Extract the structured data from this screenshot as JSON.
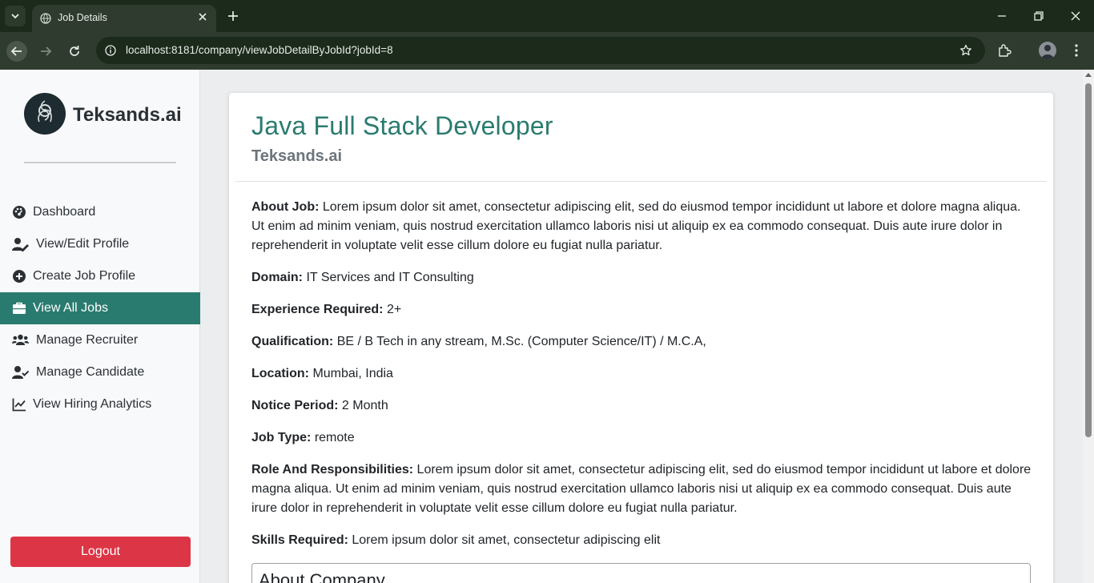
{
  "browser": {
    "tab_title": "Job Details",
    "url": "localhost:8181/company/viewJobDetailByJobId?jobId=8"
  },
  "sidebar": {
    "brand": "Teksands.ai",
    "items": [
      {
        "label": "Dashboard",
        "icon": "dashboard-icon"
      },
      {
        "label": "View/Edit Profile",
        "icon": "user-edit-icon"
      },
      {
        "label": "Create Job Profile",
        "icon": "plus-circle-icon"
      },
      {
        "label": "View All Jobs",
        "icon": "briefcase-icon",
        "active": true
      },
      {
        "label": "Manage Recruiter",
        "icon": "users-icon"
      },
      {
        "label": "Manage Candidate",
        "icon": "user-check-icon"
      },
      {
        "label": "View Hiring Analytics",
        "icon": "line-chart-icon"
      }
    ],
    "logout_label": "Logout"
  },
  "job": {
    "title": "Java Full Stack Developer",
    "company": "Teksands.ai",
    "fields": [
      {
        "label": "About Job:",
        "value": "Lorem ipsum dolor sit amet, consectetur adipiscing elit, sed do eiusmod tempor incididunt ut labore et dolore magna aliqua. Ut enim ad minim veniam, quis nostrud exercitation ullamco laboris nisi ut aliquip ex ea commodo consequat. Duis aute irure dolor in reprehenderit in voluptate velit esse cillum dolore eu fugiat nulla pariatur."
      },
      {
        "label": "Domain:",
        "value": "IT Services and IT Consulting"
      },
      {
        "label": "Experience Required:",
        "value": "2+"
      },
      {
        "label": "Qualification:",
        "value": "BE / B Tech in any stream, M.Sc. (Computer Science/IT) / M.C.A,"
      },
      {
        "label": "Location:",
        "value": "Mumbai, India"
      },
      {
        "label": "Notice Period:",
        "value": "2 Month"
      },
      {
        "label": "Job Type:",
        "value": "remote"
      },
      {
        "label": "Role And Responsibilities:",
        "value": "Lorem ipsum dolor sit amet, consectetur adipiscing elit, sed do eiusmod tempor incididunt ut labore et dolore magna aliqua. Ut enim ad minim veniam, quis nostrud exercitation ullamco laboris nisi ut aliquip ex ea commodo consequat. Duis aute irure dolor in reprehenderit in voluptate velit esse cillum dolore eu fugiat nulla pariatur."
      },
      {
        "label": "Skills Required:",
        "value": "Lorem ipsum dolor sit amet, consectetur adipiscing elit"
      }
    ],
    "about_company_title": "About Company"
  },
  "colors": {
    "accent": "#2a7b6f",
    "danger": "#dc3545",
    "browser_frame": "#1b2a1b"
  }
}
